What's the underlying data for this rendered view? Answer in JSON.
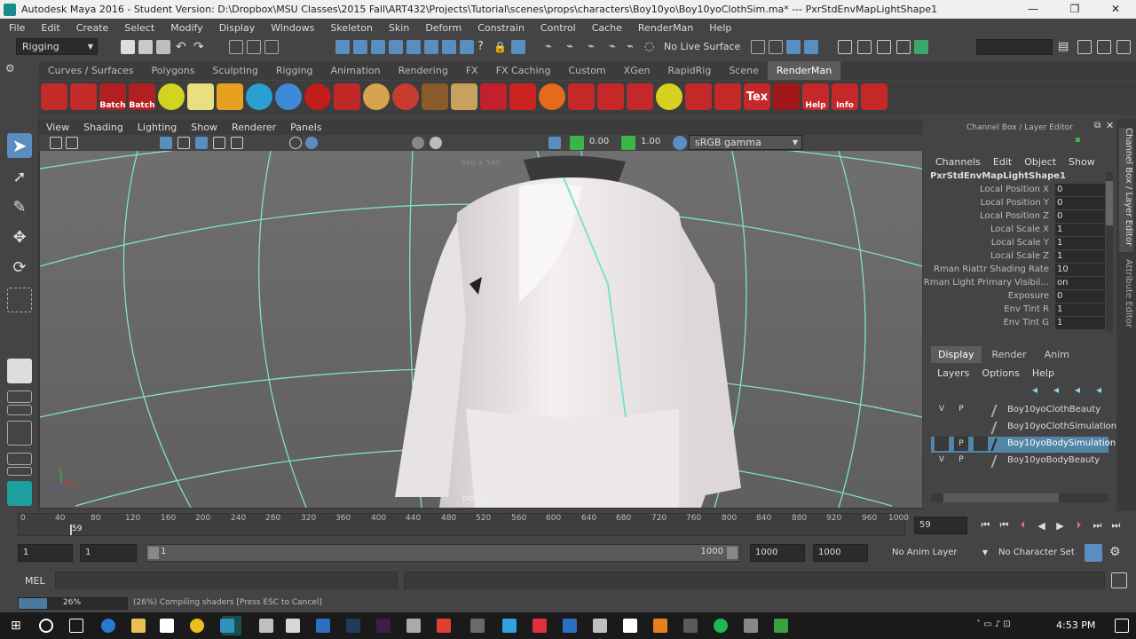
{
  "window": {
    "title": "Autodesk Maya 2016 - Student Version: D:\\Dropbox\\MSU Classes\\2015 Fall\\ART432\\Projects\\Tutorial\\scenes\\props\\characters\\Boy10yo\\Boy10yoClothSim.ma*   ---   PxrStdEnvMapLightShape1",
    "minimize": "—",
    "maximize": "❐",
    "close": "✕"
  },
  "menubar": [
    "File",
    "Edit",
    "Create",
    "Select",
    "Modify",
    "Display",
    "Windows",
    "Skeleton",
    "Skin",
    "Deform",
    "Constrain",
    "Control",
    "Cache",
    "RenderMan",
    "Help"
  ],
  "statusline": {
    "menuset": "Rigging",
    "live_surface": "No Live Surface"
  },
  "shelf_tabs": [
    "Curves / Surfaces",
    "Polygons",
    "Sculpting",
    "Rigging",
    "Animation",
    "Rendering",
    "FX",
    "FX Caching",
    "Custom",
    "XGen",
    "RapidRig",
    "Scene",
    "RenderMan"
  ],
  "shelf_active_tab": "RenderMan",
  "shelf_buttons": [
    {
      "icon": "render-grid-icon",
      "label": ""
    },
    {
      "icon": "clapper-icon",
      "label": ""
    },
    {
      "icon": "batch-render-icon",
      "label": "Batch"
    },
    {
      "icon": "batch-clapper-icon",
      "label": "Batch"
    },
    {
      "icon": "no-render-icon",
      "label": ""
    },
    {
      "icon": "eye-icon",
      "label": ""
    },
    {
      "icon": "area-light-icon",
      "label": ""
    },
    {
      "icon": "env-sphere-icon",
      "label": ""
    },
    {
      "icon": "blue-sphere-icon",
      "label": ""
    },
    {
      "icon": "material-sphere-icon",
      "label": ""
    },
    {
      "icon": "bulb-icon",
      "label": ""
    },
    {
      "icon": "dome-icon",
      "label": ""
    },
    {
      "icon": "ring-icon",
      "label": ""
    },
    {
      "icon": "table-icon",
      "label": ""
    },
    {
      "icon": "table2-icon",
      "label": ""
    },
    {
      "icon": "lips-icon",
      "label": ""
    },
    {
      "icon": "fire-icon",
      "label": ""
    },
    {
      "icon": "bake-icon",
      "label": ""
    },
    {
      "icon": "hand-icon",
      "label": ""
    },
    {
      "icon": "magnify-icon",
      "label": ""
    },
    {
      "icon": "light-node-icon",
      "label": ""
    },
    {
      "icon": "yellow-ball-icon",
      "label": ""
    },
    {
      "icon": "cross-icon",
      "label": ""
    },
    {
      "icon": "cubes-icon",
      "label": ""
    },
    {
      "icon": "tex-icon",
      "label": "Tex"
    },
    {
      "icon": "infinity-icon",
      "label": ""
    },
    {
      "icon": "help-icon",
      "label": "Help"
    },
    {
      "icon": "info-icon",
      "label": "Info"
    },
    {
      "icon": "puzzle-icon",
      "label": ""
    }
  ],
  "panel_menu": [
    "View",
    "Shading",
    "Lighting",
    "Show",
    "Renderer",
    "Panels"
  ],
  "panel_toolbar": {
    "exposure": "0.00",
    "gamma": "1.00",
    "colorspace": "sRGB gamma"
  },
  "viewport": {
    "resolution_gate": "960 x 540",
    "camera_label": "persp",
    "axis_y": "y",
    "axis_x": "x"
  },
  "channel_box": {
    "title": "Channel Box / Layer Editor",
    "menu": [
      "Channels",
      "Edit",
      "Object",
      "Show"
    ],
    "node": "PxrStdEnvMapLightShape1",
    "attributes": [
      {
        "label": "Local Position X",
        "value": "0"
      },
      {
        "label": "Local Position Y",
        "value": "0"
      },
      {
        "label": "Local Position Z",
        "value": "0"
      },
      {
        "label": "Local Scale X",
        "value": "1"
      },
      {
        "label": "Local Scale Y",
        "value": "1"
      },
      {
        "label": "Local Scale Z",
        "value": "1"
      },
      {
        "label": "Rman Riattr Shading Rate",
        "value": "10"
      },
      {
        "label": "Rman Light Primary Visibil...",
        "value": "on"
      },
      {
        "label": "Exposure",
        "value": "0"
      },
      {
        "label": "Env Tint R",
        "value": "1"
      },
      {
        "label": "Env Tint G",
        "value": "1"
      }
    ]
  },
  "layer_editor": {
    "tabs": [
      "Display",
      "Render",
      "Anim"
    ],
    "active_tab": "Display",
    "menu": [
      "Layers",
      "Options",
      "Help"
    ],
    "layers": [
      {
        "v": "V",
        "p": "P",
        "name": "Boy10yoClothBeauty",
        "selected": false
      },
      {
        "v": "",
        "p": "",
        "name": "Boy10yoClothSimulation",
        "selected": false
      },
      {
        "v": "",
        "p": "P",
        "name": "Boy10yoBodySimulation",
        "selected": true
      },
      {
        "v": "V",
        "p": "P",
        "name": "Boy10yoBodyBeauty",
        "selected": false
      }
    ]
  },
  "side_tabs": [
    "Channel Box / Layer Editor",
    "Attribute Editor"
  ],
  "time_slider": {
    "ticks": [
      "0",
      "40",
      "80",
      "120",
      "160",
      "200",
      "240",
      "280",
      "320",
      "360",
      "400",
      "440",
      "480",
      "520",
      "560",
      "600",
      "640",
      "680",
      "720",
      "760",
      "800",
      "840",
      "880",
      "920",
      "960",
      "1000"
    ],
    "current_frame_marker": "59",
    "current_frame": "59"
  },
  "range_slider": {
    "start": "1",
    "playback_start": "1",
    "range_start": "1",
    "range_end": "1000",
    "playback_end": "1000",
    "end": "1000",
    "anim_layer": "No Anim Layer",
    "character_set": "No Character Set"
  },
  "command_line": {
    "label": "MEL"
  },
  "help_line": {
    "progress_percent": 26,
    "progress_label": "26%",
    "message": "(26%) Compiling shaders [Press ESC to Cancel]"
  },
  "taskbar": {
    "time": "4:53 PM"
  }
}
